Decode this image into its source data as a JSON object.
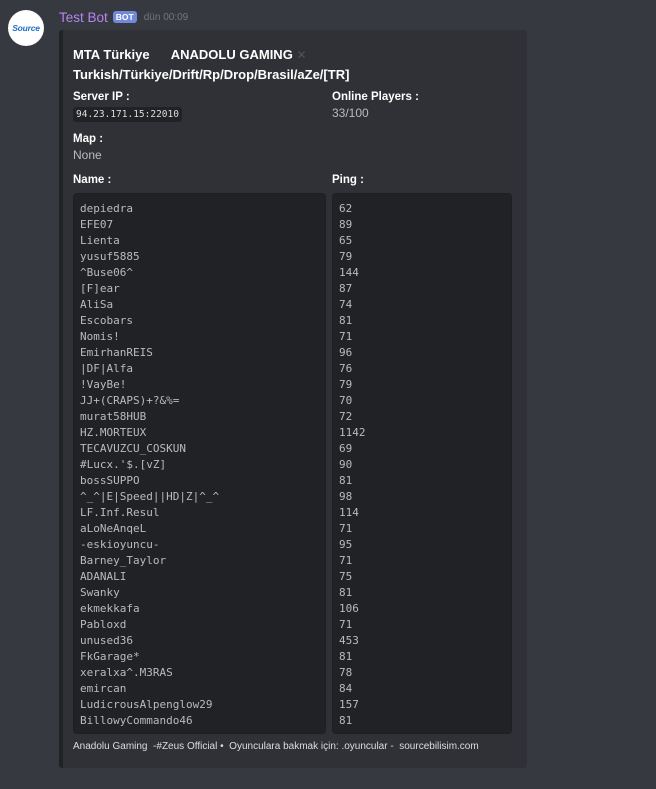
{
  "author": {
    "avatar_text": "Source",
    "name": "Test Bot",
    "bot_tag": "BOT",
    "timestamp": "dün 00:09"
  },
  "embed": {
    "title_line1": "MTA Türkiye      ANADOLU GAMING",
    "title_line2": "Turkish/Türkiye/Drift/Rp/Drop/Brasil/aZe/[TR]",
    "close_glyph": "✕",
    "server_ip_label": "Server IP :",
    "server_ip_value": "94.23.171.15:22010",
    "online_label": "Online Players :",
    "online_value": "33/100",
    "map_label": "Map :",
    "map_value": "None",
    "name_label": "Name :",
    "ping_label": "Ping :",
    "players": [
      {
        "name": "depiedra",
        "ping": "62"
      },
      {
        "name": "EFE07",
        "ping": "89"
      },
      {
        "name": "Lienta",
        "ping": "65"
      },
      {
        "name": "yusuf5885",
        "ping": "79"
      },
      {
        "name": "^Buse06^",
        "ping": "144"
      },
      {
        "name": "[F]ear",
        "ping": "87"
      },
      {
        "name": "AliSa",
        "ping": "74"
      },
      {
        "name": "Escobars",
        "ping": "81"
      },
      {
        "name": "Nomis!",
        "ping": "71"
      },
      {
        "name": "EmirhanREIS",
        "ping": "96"
      },
      {
        "name": "|DF|Alfa",
        "ping": "76"
      },
      {
        "name": "!VayBe!",
        "ping": "79"
      },
      {
        "name": "JJ+(CRAPS)+?&%=",
        "ping": "70"
      },
      {
        "name": "murat58HUB",
        "ping": "72"
      },
      {
        "name": "HZ.MORTEUX",
        "ping": "1142"
      },
      {
        "name": "TECAVUZCU_COSKUN",
        "ping": "69"
      },
      {
        "name": "#Lucx.'$.[vZ]",
        "ping": "90"
      },
      {
        "name": "bossSUPPO",
        "ping": "81"
      },
      {
        "name": "^_^|E|Speed||HD|Z|^_^",
        "ping": "98"
      },
      {
        "name": "LF.Inf.Resul",
        "ping": "114"
      },
      {
        "name": "aLoNeAnqeL",
        "ping": "71"
      },
      {
        "name": "-eskioyuncu-",
        "ping": "95"
      },
      {
        "name": "Barney_Taylor",
        "ping": "71"
      },
      {
        "name": "ADANALI",
        "ping": "75"
      },
      {
        "name": "Swanky",
        "ping": "81"
      },
      {
        "name": "ekmekkafa",
        "ping": "106"
      },
      {
        "name": "Pabloxd",
        "ping": "71"
      },
      {
        "name": "unused36",
        "ping": "453"
      },
      {
        "name": "FkGarage*",
        "ping": "81"
      },
      {
        "name": "xeralxa^.M3RAS",
        "ping": "78"
      },
      {
        "name": "emircan",
        "ping": "84"
      },
      {
        "name": "LudicrousAlpenglow29",
        "ping": "157"
      },
      {
        "name": "BillowyCommando46",
        "ping": "81"
      }
    ],
    "footer": "Anadolu Gaming  -#Zeus Official •  Oyunculara bakmak için: .oyuncular -  sourcebilisim.com"
  }
}
